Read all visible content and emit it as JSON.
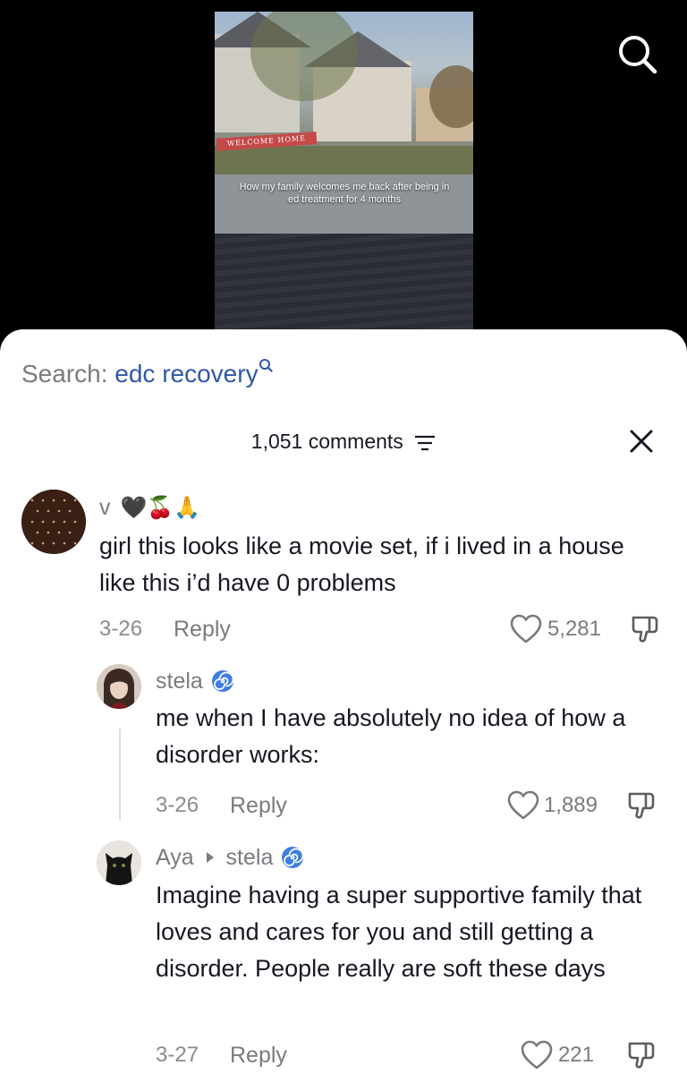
{
  "video": {
    "caption": "How my family welcomes me back after being in ed treatment for 4 months",
    "banner_text": "WELCOME HOME"
  },
  "search": {
    "prefix": "Search:",
    "term": "edc recovery"
  },
  "comments_header": {
    "count_label": "1,051 comments"
  },
  "comments": [
    {
      "username": "v",
      "emojis": "🖤🍒🙏",
      "text": "girl this looks like a movie set, if i lived in a house like this i’d have 0 problems",
      "date": "3-26",
      "reply_label": "Reply",
      "likes": "5,281"
    },
    {
      "username": "stela",
      "text": "me when I have absolutely no idea of how a disorder works:",
      "date": "3-26",
      "reply_label": "Reply",
      "likes": "1,889"
    },
    {
      "username": "Aya",
      "reply_to": "stela",
      "text": "Imagine having a super supportive family that loves and cares for you and still getting a disorder. People really are soft these days",
      "date": "3-27",
      "reply_label": "Reply",
      "likes": "221"
    }
  ],
  "colors": {
    "search_term": "#2f58a8",
    "muted_text": "#7a7b80",
    "primary_text": "#161823",
    "spiral_badge": "#3f7de0"
  },
  "icons": [
    "search-icon",
    "search-glyph-icon",
    "filter-icon",
    "close-icon",
    "heart-icon",
    "dislike-icon",
    "spiral-icon",
    "reply-arrow-icon"
  ]
}
